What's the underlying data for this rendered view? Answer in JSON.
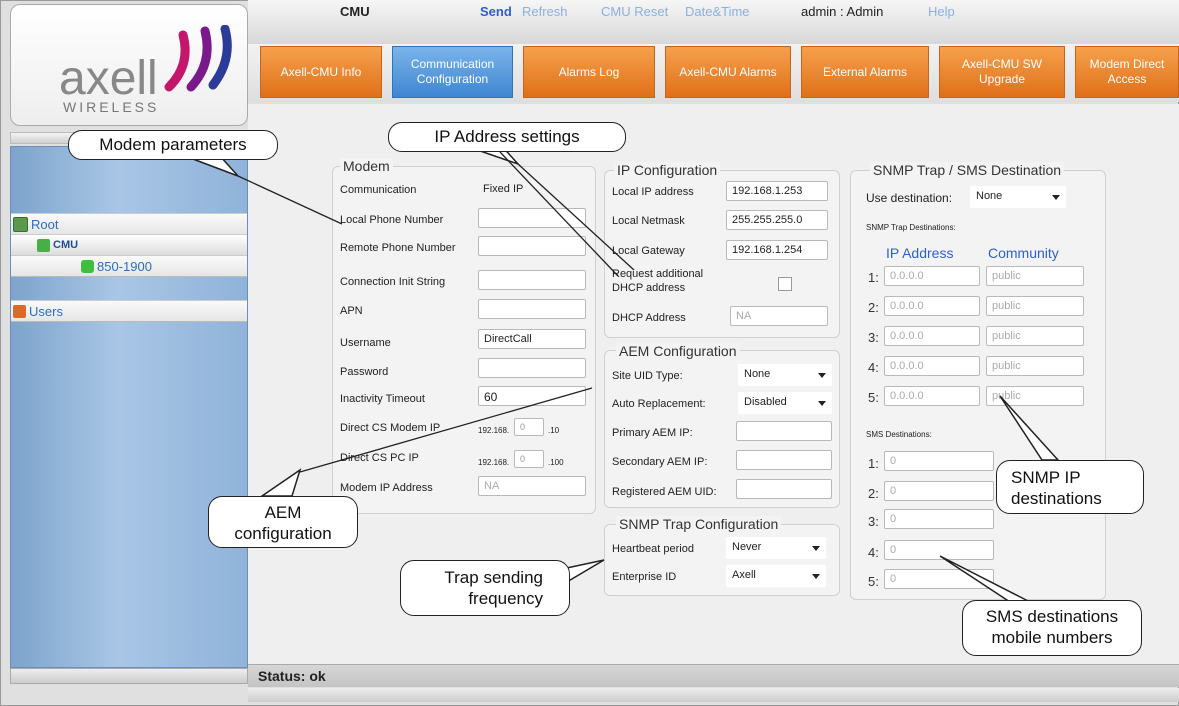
{
  "brand": {
    "name": "axell",
    "sub": "WIRELESS"
  },
  "topmenu": {
    "device": "CMU",
    "send": "Send",
    "refresh": "Refresh",
    "reset": "CMU Reset",
    "datetime": "Date&Time",
    "user": "admin : Admin",
    "help": "Help"
  },
  "tabs": [
    {
      "label": "Axell-CMU Info"
    },
    {
      "label": "Communication Configuration"
    },
    {
      "label": "Alarms Log"
    },
    {
      "label": "Axell-CMU Alarms"
    },
    {
      "label": "External Alarms"
    },
    {
      "label": "Axell-CMU SW Upgrade"
    },
    {
      "label": "Modem Direct Access"
    }
  ],
  "tree": {
    "root": "Root",
    "cmu": "CMU",
    "band": "850-1900",
    "users": "Users"
  },
  "modem": {
    "title": "Modem",
    "communication_label": "Communication",
    "communication_value": "Fixed IP",
    "local_phone_label": "Local Phone Number",
    "local_phone_value": "",
    "remote_phone_label": "Remote Phone Number",
    "remote_phone_value": "",
    "init_label": "Connection Init String",
    "init_value": "",
    "apn_label": "APN",
    "apn_value": "",
    "username_label": "Username",
    "username_value": "DirectCall",
    "password_label": "Password",
    "password_value": "",
    "timeout_label": "Inactivity Timeout",
    "timeout_value": "60",
    "cs_modem_label": "Direct CS Modem IP",
    "cs_modem_prefix": "192.168.",
    "cs_modem_octet": "0",
    "cs_modem_suffix": ".10",
    "cs_pc_label": "Direct CS PC IP",
    "cs_pc_prefix": "192.168.",
    "cs_pc_octet": "0",
    "cs_pc_suffix": ".100",
    "modem_ip_label": "Modem IP Address",
    "modem_ip_value": "NA"
  },
  "ip": {
    "title": "IP Configuration",
    "local_ip_label": "Local IP address",
    "local_ip_value": "192.168.1.253",
    "netmask_label": "Local Netmask",
    "netmask_value": "255.255.255.0",
    "gateway_label": "Local Gateway",
    "gateway_value": "192.168.1.254",
    "dhcp_req_label1": "Request additional",
    "dhcp_req_label2": "DHCP address",
    "dhcp_addr_label": "DHCP Address",
    "dhcp_addr_value": "NA"
  },
  "aem": {
    "title": "AEM Configuration",
    "site_label": "Site UID Type:",
    "site_value": "None",
    "auto_label": "Auto Replacement:",
    "auto_value": "Disabled",
    "primary_label": "Primary AEM IP:",
    "primary_value": "",
    "secondary_label": "Secondary AEM IP:",
    "secondary_value": "",
    "registered_label": "Registered AEM UID:",
    "registered_value": ""
  },
  "snmp_trap": {
    "title": "SNMP Trap Configuration",
    "heartbeat_label": "Heartbeat period",
    "heartbeat_value": "Never",
    "enterprise_label": "Enterprise ID",
    "enterprise_value": "Axell"
  },
  "dest": {
    "title": "SNMP Trap / SMS Destination",
    "use_label": "Use destination:",
    "use_value": "None",
    "trap_dest_label": "SNMP Trap Destinations:",
    "ip_col": "IP Address",
    "community_col": "Community",
    "rows": [
      {
        "n": "1:",
        "ip": "0.0.0.0",
        "community": "public"
      },
      {
        "n": "2:",
        "ip": "0.0.0.0",
        "community": "public"
      },
      {
        "n": "3:",
        "ip": "0.0.0.0",
        "community": "public"
      },
      {
        "n": "4:",
        "ip": "0.0.0.0",
        "community": "public"
      },
      {
        "n": "5:",
        "ip": "0.0.0.0",
        "community": "public"
      }
    ],
    "sms_label": "SMS Destinations:",
    "sms": [
      {
        "n": "1:",
        "v": "0"
      },
      {
        "n": "2:",
        "v": "0"
      },
      {
        "n": "3:",
        "v": "0"
      },
      {
        "n": "4:",
        "v": "0"
      },
      {
        "n": "5:",
        "v": "0"
      }
    ]
  },
  "status": "Status: ok",
  "callouts": {
    "modem": "Modem parameters",
    "ip": "IP Address settings",
    "aem": "AEM configuration",
    "trap": "Trap sending frequency",
    "snmp_ip": "SNMP IP destinations",
    "sms": "SMS destinations mobile numbers"
  },
  "colors": {
    "tab_orange": "#e8802a",
    "tab_active": "#4a8fd6",
    "tree_blue": "#8fb3d9",
    "link_blue": "#2f5fcc"
  }
}
